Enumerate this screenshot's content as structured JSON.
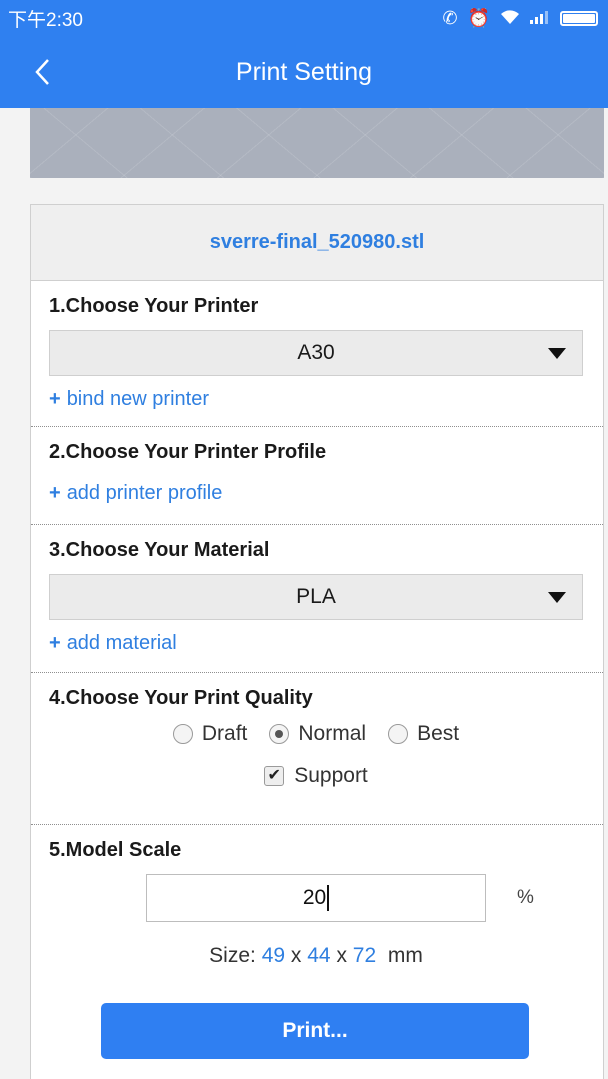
{
  "status_bar": {
    "time": "下午2:30",
    "icons": [
      "bluetooth-off-icon",
      "alarm-icon",
      "wifi-icon",
      "signal-icon",
      "battery-icon"
    ]
  },
  "app_bar": {
    "title": "Print Setting",
    "back_icon": "chevron-left-icon"
  },
  "file": {
    "name": "sverre-final_520980.stl"
  },
  "printer": {
    "title": "1.Choose Your Printer",
    "selected": "A30",
    "link": "bind new printer"
  },
  "profile": {
    "title": "2.Choose Your Printer Profile",
    "link": "add printer profile"
  },
  "material": {
    "title": "3.Choose Your Material",
    "selected": "PLA",
    "link": "add material"
  },
  "quality": {
    "title": "4.Choose Your Print Quality",
    "options": [
      "Draft",
      "Normal",
      "Best"
    ],
    "selected": "Normal",
    "support_label": "Support",
    "support_checked": true
  },
  "scale": {
    "title": "5.Model Scale",
    "value": "20",
    "unit": "%",
    "size_label": "Size:",
    "size_x": "49",
    "size_y": "44",
    "size_z": "72",
    "separator": "x",
    "size_unit": "mm"
  },
  "print_button": "Print...",
  "colors": {
    "accent": "#2f80f0",
    "link": "#2f7fe0"
  }
}
